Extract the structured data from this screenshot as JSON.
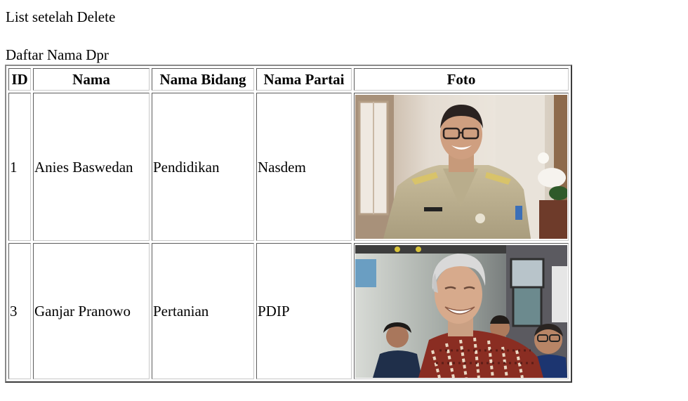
{
  "page": {
    "heading": "List setelah Delete",
    "table_caption": "Daftar Nama Dpr"
  },
  "table": {
    "headers": [
      "ID",
      "Nama",
      "Nama Bidang",
      "Nama Partai",
      "Foto"
    ],
    "rows": [
      {
        "id": "1",
        "nama": "Anies Baswedan",
        "bidang": "Pendidikan",
        "partai": "Nasdem",
        "foto": "portrait-photo"
      },
      {
        "id": "3",
        "nama": "Ganjar Pranowo",
        "bidang": "Pertanian",
        "partai": "PDIP",
        "foto": "portrait-photo"
      }
    ]
  },
  "colors": {
    "table_outer_border": "#3c3c3c",
    "cell_border": "#5c5c5c"
  }
}
